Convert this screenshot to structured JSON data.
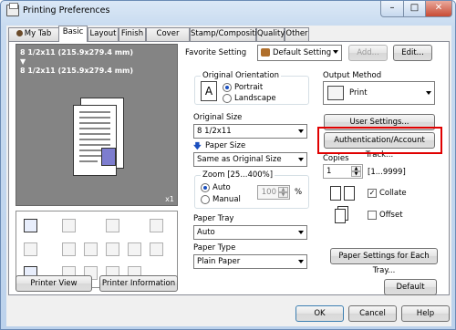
{
  "window": {
    "title": "Printing Preferences",
    "minimize": "–",
    "maximize": "□",
    "close": "✕"
  },
  "tabs": [
    "My Tab",
    "Basic",
    "Layout",
    "Finish",
    "Cover Mode",
    "Stamp/Composition",
    "Quality",
    "Other"
  ],
  "preview": {
    "line1": "8 1/2x11 (215.9x279.4 mm)",
    "arrow": "▼",
    "line2": "8 1/2x11 (215.9x279.4 mm)",
    "copies": "x1"
  },
  "left_buttons": {
    "printer_view": "Printer View",
    "printer_information": "Printer Information"
  },
  "favorite": {
    "label": "Favorite Setting",
    "value": "Default Setting",
    "add": "Add...",
    "edit": "Edit..."
  },
  "orientation": {
    "title": "Original Orientation",
    "portrait": "Portrait",
    "landscape": "Landscape",
    "selected": "Portrait"
  },
  "original_size": {
    "label": "Original Size",
    "value": "8 1/2x11"
  },
  "paper_size": {
    "label": "Paper Size",
    "value": "Same as Original Size"
  },
  "zoom": {
    "title": "Zoom [25...400%]",
    "auto": "Auto",
    "manual": "Manual",
    "value": "100",
    "unit": "%"
  },
  "paper_tray": {
    "label": "Paper Tray",
    "value": "Auto"
  },
  "paper_type": {
    "label": "Paper Type",
    "value": "Plain Paper"
  },
  "output": {
    "label": "Output Method",
    "value": "Print"
  },
  "user_settings": "User Settings...",
  "auth": "Authentication/Account Track...",
  "copies": {
    "label": "Copies",
    "value": "1",
    "range": "[1...9999]"
  },
  "collate": {
    "label": "Collate",
    "checked": true,
    "mark": "✓"
  },
  "offset": {
    "label": "Offset",
    "checked": false
  },
  "paper_settings_each_tray": "Paper Settings for Each Tray...",
  "default": "Default",
  "dialog": {
    "ok": "OK",
    "cancel": "Cancel",
    "help": "Help"
  },
  "colors": {
    "highlight": "#e00000",
    "accent": "#1a4fbf"
  }
}
